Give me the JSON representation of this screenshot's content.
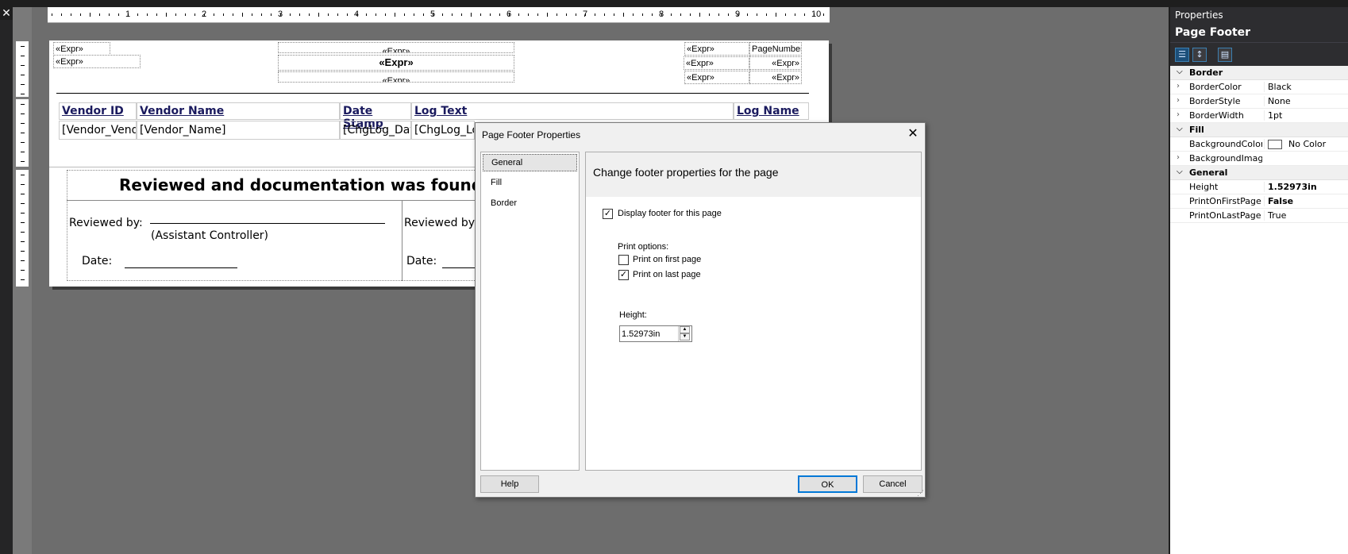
{
  "app": {
    "close_glyph": "✕"
  },
  "ruler": {
    "numbers": [
      "1",
      "2",
      "3",
      "4",
      "5",
      "6",
      "7",
      "8",
      "9",
      "10"
    ]
  },
  "report": {
    "header_exprs": {
      "left1": "«Expr»",
      "left2": "«Expr»",
      "center_top": "«Expr»",
      "center_bold": "«Expr»",
      "center_bottom": "«Expr»",
      "right1": "«Expr»",
      "right_page": "PageNumber]",
      "right2": "«Expr»",
      "right3": "«Expr»",
      "right4": "«Expr»",
      "right5": "«Expr»"
    },
    "columns": [
      "Vendor ID",
      "Vendor Name",
      "Date Stamp",
      "Log Text",
      "Log Name"
    ],
    "row": [
      "[Vendor_Vendor",
      "[Vendor_Name]",
      "[ChgLog_Date:",
      "[ChgLog_Log"
    ],
    "footer": {
      "title": "Reviewed and documentation was found in a",
      "reviewed_by_1": "Reviewed by:",
      "assistant_controller": "(Assistant Controller)",
      "date_1": "Date:",
      "reviewed_by_2": "Reviewed by:",
      "date_2": "Date:"
    }
  },
  "properties": {
    "title": "Properties",
    "object": "Page Footer",
    "categories": {
      "border": "Border",
      "fill": "Fill",
      "general": "General"
    },
    "rows": {
      "border_color": {
        "name": "BorderColor",
        "value": "Black"
      },
      "border_style": {
        "name": "BorderStyle",
        "value": "None"
      },
      "border_width": {
        "name": "BorderWidth",
        "value": "1pt"
      },
      "background_color": {
        "name": "BackgroundColor",
        "value": "No Color"
      },
      "background_image": {
        "name": "BackgroundImage",
        "value": ""
      },
      "height": {
        "name": "Height",
        "value": "1.52973in"
      },
      "print_first": {
        "name": "PrintOnFirstPage",
        "value": "False"
      },
      "print_last": {
        "name": "PrintOnLastPage",
        "value": "True"
      }
    }
  },
  "dialog": {
    "title": "Page Footer Properties",
    "close_glyph": "✕",
    "nav": [
      "General",
      "Fill",
      "Border"
    ],
    "heading": "Change footer properties for the page",
    "display_footer": {
      "label": "Display footer for this page",
      "checked": true
    },
    "print_options_label": "Print options:",
    "print_first": {
      "label": "Print on first page",
      "checked": false
    },
    "print_last": {
      "label": "Print on last page",
      "checked": true
    },
    "height_label": "Height:",
    "height_value": "1.52973in",
    "buttons": {
      "help": "Help",
      "ok": "OK",
      "cancel": "Cancel"
    }
  },
  "colors": {
    "accent": "#0078d7",
    "panel_dark": "#2d2d30",
    "canvas": "#6d6d6d"
  },
  "icons": [
    "categorized-icon",
    "alphabetical-icon",
    "property-pages-icon",
    "check-icon",
    "spin-up-icon",
    "spin-down-icon",
    "close-icon",
    "resize-grip-icon"
  ]
}
